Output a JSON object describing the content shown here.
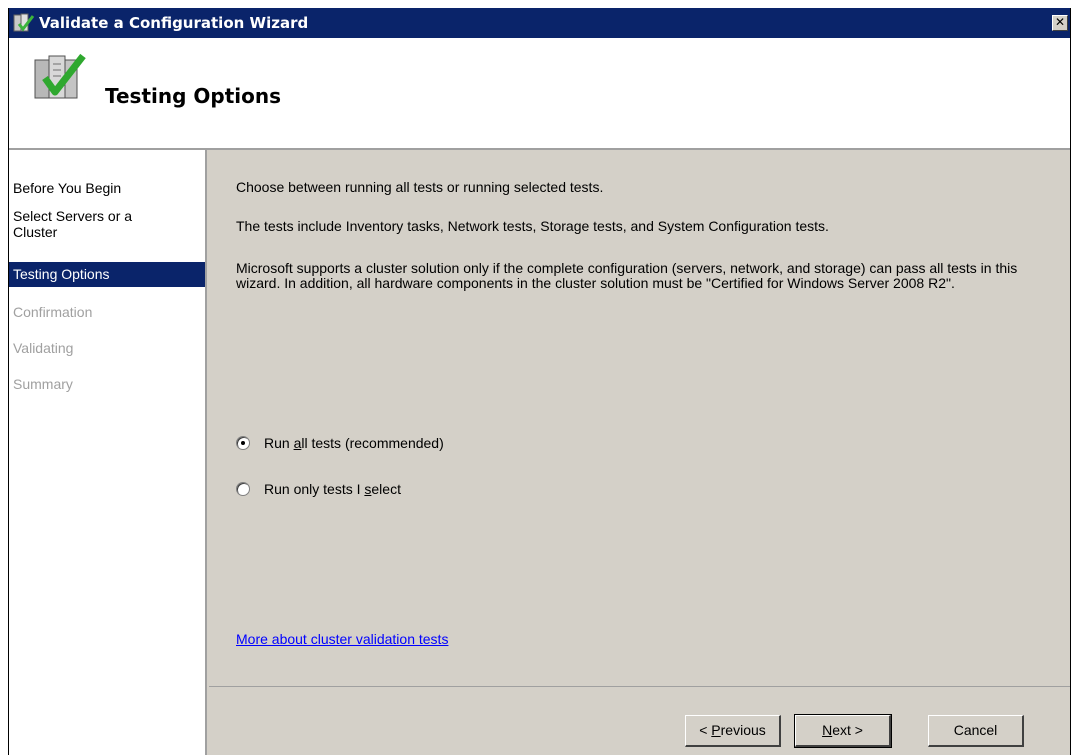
{
  "window": {
    "title": "Validate a Configuration Wizard",
    "close_label": "✕"
  },
  "header": {
    "title": "Testing Options"
  },
  "nav": {
    "items": [
      {
        "label": "Before You Begin",
        "state": "normal"
      },
      {
        "label": "Select Servers or a Cluster",
        "state": "normal"
      },
      {
        "label": "Testing Options",
        "state": "selected"
      },
      {
        "label": "Confirmation",
        "state": "disabled"
      },
      {
        "label": "Validating",
        "state": "disabled"
      },
      {
        "label": "Summary",
        "state": "disabled"
      }
    ]
  },
  "content": {
    "intro": "Choose between running all tests or running selected tests.",
    "tests_description": "The tests include Inventory tasks, Network tests, Storage tests, and System Configuration tests.",
    "support_note": "Microsoft supports a cluster solution only if the complete configuration (servers, network, and storage) can pass all tests in this wizard. In addition, all hardware components in the cluster solution must be \"Certified for Windows Server 2008 R2\".",
    "options": [
      {
        "label_pre": "Run ",
        "label_key": "a",
        "label_post": "ll tests (recommended)",
        "checked": true
      },
      {
        "label_pre": "Run only tests I ",
        "label_key": "s",
        "label_post": "elect",
        "checked": false
      }
    ],
    "link": "More about cluster validation tests"
  },
  "buttons": {
    "previous": {
      "pre": "< ",
      "key": "P",
      "post": "revious"
    },
    "next": {
      "pre": "",
      "key": "N",
      "post": "ext >"
    },
    "cancel": "Cancel"
  }
}
